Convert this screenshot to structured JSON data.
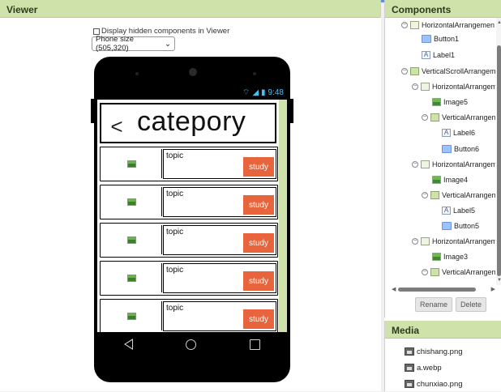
{
  "viewer": {
    "header": "Viewer",
    "hidden_components_label": "Display hidden components in Viewer",
    "phone_size": "Phone size (505,320)",
    "status_time": "9:48",
    "title": "catepory",
    "back_label": "<",
    "rows": [
      {
        "topic": "topic",
        "button": "study"
      },
      {
        "topic": "topic",
        "button": "study"
      },
      {
        "topic": "topic",
        "button": "study"
      },
      {
        "topic": "topic",
        "button": "study"
      },
      {
        "topic": "topic",
        "button": "study"
      }
    ]
  },
  "components": {
    "header": "Components",
    "items": [
      {
        "label": "HorizontalArrangemen",
        "icon": "horizontal-arrangement-icon",
        "toggle": "⊟"
      },
      {
        "label": "Button1",
        "icon": "button-icon"
      },
      {
        "label": "Label1",
        "icon": "label-icon"
      },
      {
        "label": "VerticalScrollArrangem",
        "icon": "vertical-arrangement-icon",
        "toggle": "⊟"
      },
      {
        "label": "HorizontalArrangem",
        "icon": "horizontal-arrangement-icon",
        "toggle": "⊟"
      },
      {
        "label": "Image5",
        "icon": "image-icon"
      },
      {
        "label": "VerticalArrangem",
        "icon": "vertical-arrangement-icon",
        "toggle": "⊟"
      },
      {
        "label": "Label6",
        "icon": "label-icon"
      },
      {
        "label": "Button6",
        "icon": "button-icon"
      },
      {
        "label": "HorizontalArrangem",
        "icon": "horizontal-arrangement-icon",
        "toggle": "⊟"
      },
      {
        "label": "Image4",
        "icon": "image-icon"
      },
      {
        "label": "VerticalArrangem",
        "icon": "vertical-arrangement-icon",
        "toggle": "⊟"
      },
      {
        "label": "Label5",
        "icon": "label-icon"
      },
      {
        "label": "Button5",
        "icon": "button-icon"
      },
      {
        "label": "HorizontalArrangem",
        "icon": "horizontal-arrangement-icon",
        "toggle": "⊟"
      },
      {
        "label": "Image3",
        "icon": "image-icon"
      },
      {
        "label": "VerticalArrangem",
        "icon": "vertical-arrangement-icon",
        "toggle": "⊟"
      }
    ],
    "rename": "Rename",
    "delete": "Delete"
  },
  "media": {
    "header": "Media",
    "files": [
      "chishang.png",
      "a.webp",
      "chunxiao.png"
    ]
  },
  "colors": {
    "panel_header": "#cfe2a9",
    "study_button": "#e8643c",
    "status_icons": "#3fc3ff"
  }
}
